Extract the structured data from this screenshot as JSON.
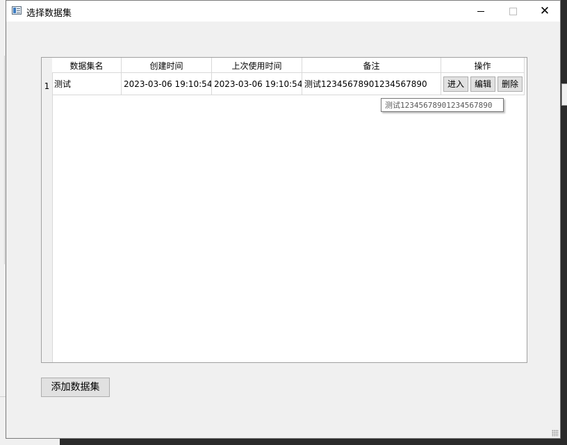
{
  "window": {
    "title": "选择数据集",
    "minimize_icon": "minimize-icon",
    "maximize_icon": "maximize-icon",
    "close_glyph": "✕"
  },
  "table": {
    "columns": [
      "数据集名",
      "创建时间",
      "上次使用时间",
      "备注",
      "操作"
    ],
    "rows": [
      {
        "index": "1",
        "name": "测试",
        "created": "2023-03-06 19:10:54",
        "last_used": "2023-03-06 19:10:54",
        "note": "测试12345678901234567890",
        "actions": [
          "进入",
          "编辑",
          "删除"
        ]
      }
    ]
  },
  "tooltip": {
    "text": "测试12345678901234567890"
  },
  "add_button": {
    "label": "添加数据集"
  }
}
